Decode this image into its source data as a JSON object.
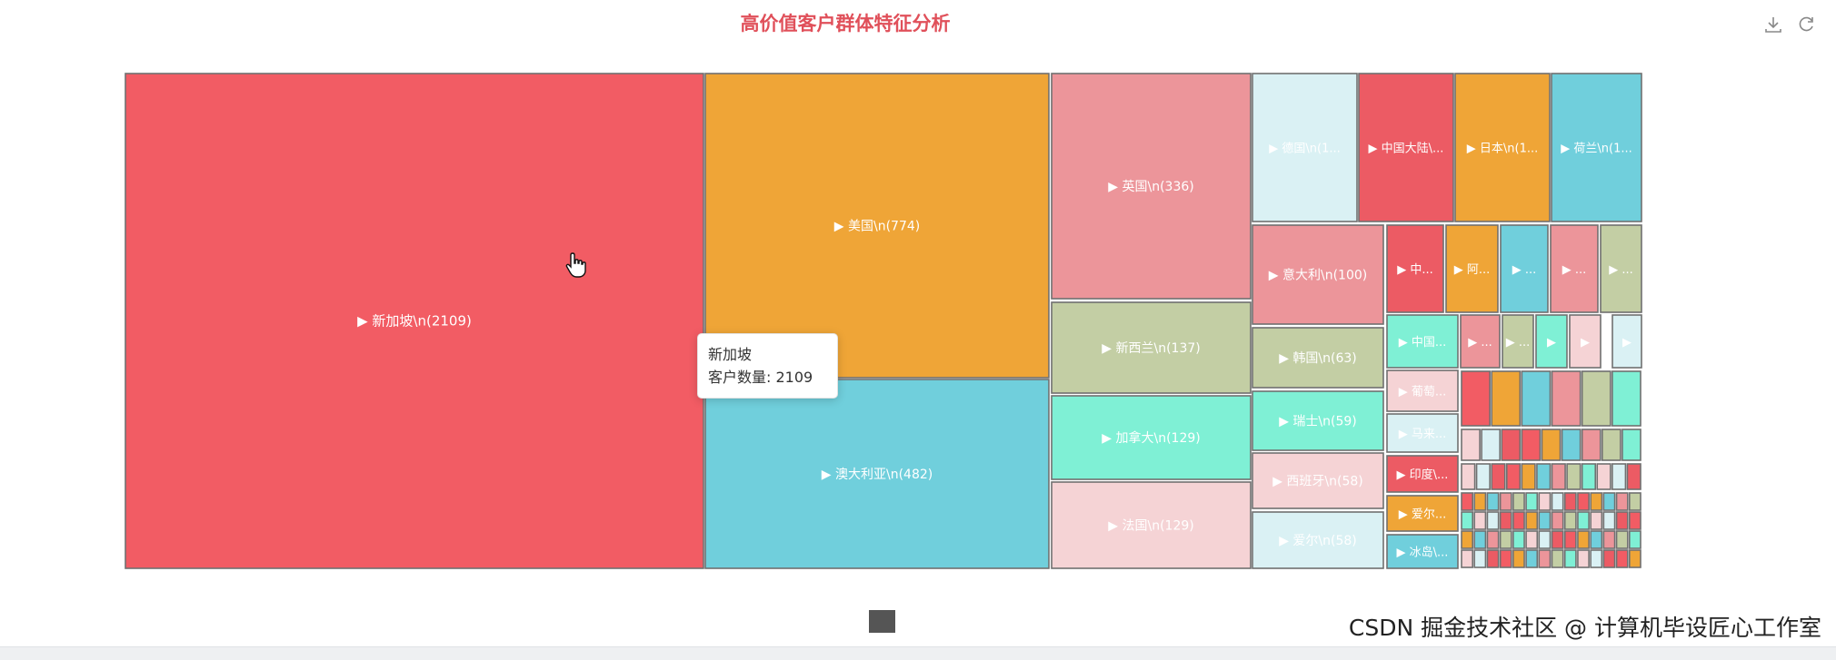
{
  "chart_data": {
    "type": "treemap",
    "title": "高价值客户群体特征分析",
    "nodes": [
      {
        "label": "▶ 新加坡\\n(2109)",
        "name": "新加坡",
        "value": 2109,
        "color": "#f25c64"
      },
      {
        "label": "▶ 美国\\n(774)",
        "name": "美国",
        "value": 774,
        "color": "#efa537"
      },
      {
        "label": "▶ 澳大利亚\\n(482)",
        "name": "澳大利亚",
        "value": 482,
        "color": "#70cfdc"
      },
      {
        "label": "▶ 英国\\n(336)",
        "name": "英国",
        "value": 336,
        "color": "#ec959a"
      },
      {
        "label": "▶ 新西兰\\n(137)",
        "name": "新西兰",
        "value": 137,
        "color": "#c3cea4"
      },
      {
        "label": "▶ 加拿大\\n(129)",
        "name": "加拿大",
        "value": 129,
        "color": "#7ff0d5"
      },
      {
        "label": "▶ 法国\\n(129)",
        "name": "法国",
        "value": 129,
        "color": "#f5d3d5"
      },
      {
        "label": "▶ 德国\\n(1...",
        "value": null,
        "color": "#daf1f4"
      },
      {
        "label": "▶ 中国大陆\\...",
        "value": null,
        "color": "#ec5b64"
      },
      {
        "label": "▶ 日本\\n(1...",
        "value": null,
        "color": "#efa537"
      },
      {
        "label": "▶ 荷兰\\n(1...",
        "value": null,
        "color": "#70cfdc"
      },
      {
        "label": "▶ 意大利\\n(100)",
        "name": "意大利",
        "value": 100,
        "color": "#ec959a"
      },
      {
        "label": "▶ 韩国\\n(63)",
        "name": "韩国",
        "value": 63,
        "color": "#c3cea4"
      },
      {
        "label": "▶ 瑞士\\n(59)",
        "name": "瑞士",
        "value": 59,
        "color": "#7ff0d5"
      },
      {
        "label": "▶ 西班牙\\n(58)",
        "name": "西班牙",
        "value": 58,
        "color": "#f5d3d5"
      },
      {
        "label": "▶ 爱尔\\n(58)",
        "value": 58,
        "color": "#daf1f4"
      },
      {
        "label": "▶ 中...",
        "color": "#ec5b64"
      },
      {
        "label": "▶ 阿...",
        "color": "#efa537"
      },
      {
        "label": "▶ ...",
        "color": "#70cfdc"
      },
      {
        "label": "▶ ...",
        "color": "#ec959a"
      },
      {
        "label": "▶ ...",
        "color": "#c3cea4"
      },
      {
        "label": "▶ 中国...",
        "color": "#7ff0d5"
      },
      {
        "label": "▶ ...",
        "color": "#ec959a"
      },
      {
        "label": "▶ ...",
        "color": "#c3cea4"
      },
      {
        "label": "▶",
        "color": "#7ff0d5"
      },
      {
        "label": "▶",
        "color": "#f5d3d5"
      },
      {
        "label": "▶",
        "color": "#daf1f4"
      },
      {
        "label": "▶ 葡萄...",
        "color": "#f5d3d5"
      },
      {
        "label": "▶ 马来...",
        "color": "#daf1f4"
      },
      {
        "label": "▶ 印度\\...",
        "color": "#ec5b64"
      },
      {
        "label": "▶ 爱尔...",
        "color": "#efa537"
      },
      {
        "label": "▶ 冰岛\\...",
        "color": "#70cfdc"
      }
    ],
    "palette": [
      "#f25c64",
      "#efa537",
      "#70cfdc",
      "#ec959a",
      "#c3cea4",
      "#7ff0d5",
      "#f5d3d5",
      "#daf1f4",
      "#ec5b64"
    ]
  },
  "tooltip": {
    "name": "新加坡",
    "label": "客户数量: 2109"
  },
  "toolbox": {
    "icons": [
      "download-icon",
      "refresh-icon"
    ]
  },
  "watermark": "CSDN 掘金技术社区 @ 计算机毕设匠心工作室",
  "colors": {
    "title": "#e0505a",
    "border": "#707070"
  }
}
